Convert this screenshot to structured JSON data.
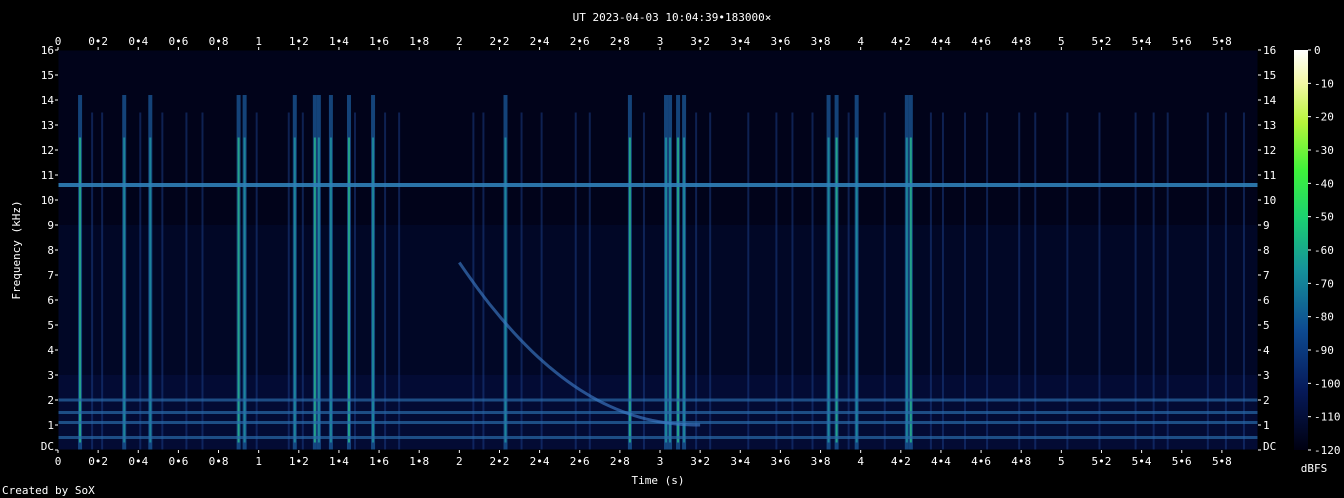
{
  "chart_data": {
    "type": "heatmap",
    "title": "UT 2023-04-03 10:04:39•183000×",
    "xlabel": "Time (s)",
    "ylabel": "Frequency (kHz)",
    "xlim": [
      0,
      5.98
    ],
    "ylim": [
      0,
      16
    ],
    "x_ticks": [
      "0",
      "0•2",
      "0•4",
      "0•6",
      "0•8",
      "1",
      "1•2",
      "1•4",
      "1•6",
      "1•8",
      "2",
      "2•2",
      "2•4",
      "2•6",
      "2•8",
      "3",
      "3•2",
      "3•4",
      "3•6",
      "3•8",
      "4",
      "4•2",
      "4•4",
      "4•6",
      "4•8",
      "5",
      "5•2",
      "5•4",
      "5•6",
      "5•8"
    ],
    "x_tick_values": [
      0,
      0.2,
      0.4,
      0.6,
      0.8,
      1,
      1.2,
      1.4,
      1.6,
      1.8,
      2,
      2.2,
      2.4,
      2.6,
      2.8,
      3,
      3.2,
      3.4,
      3.6,
      3.8,
      4,
      4.2,
      4.4,
      4.6,
      4.8,
      5,
      5.2,
      5.4,
      5.6,
      5.8
    ],
    "y_ticks": [
      "DC",
      "1",
      "2",
      "3",
      "4",
      "5",
      "6",
      "7",
      "8",
      "9",
      "10",
      "11",
      "12",
      "13",
      "14",
      "15",
      "16"
    ],
    "colorbar": {
      "label": "dBFS",
      "range": [
        -120,
        0
      ],
      "ticks": [
        "0",
        "-10",
        "-20",
        "-30",
        "-40",
        "-50",
        "-60",
        "-70",
        "-80",
        "-90",
        "-100",
        "-110",
        "-120"
      ]
    },
    "features": {
      "tone_khz": 10.6,
      "low_bands_khz": [
        0.5,
        1.1,
        1.5,
        2.0
      ],
      "spheric_times_s": [
        0.11,
        0.33,
        0.46,
        0.9,
        0.93,
        1.18,
        1.28,
        1.3,
        1.36,
        1.45,
        1.57,
        2.23,
        2.85,
        3.03,
        3.05,
        3.09,
        3.12,
        3.84,
        3.88,
        3.98,
        4.23,
        4.25
      ],
      "faint_line_times_s": [
        0.17,
        0.22,
        0.41,
        0.52,
        0.64,
        0.72,
        0.99,
        1.15,
        1.22,
        1.48,
        1.63,
        1.7,
        2.07,
        2.12,
        2.31,
        2.41,
        2.58,
        2.65,
        2.92,
        3.18,
        3.25,
        3.44,
        3.58,
        3.66,
        3.76,
        3.94,
        4.12,
        4.35,
        4.41,
        4.52,
        4.63,
        4.79,
        4.87,
        5.03,
        5.19,
        5.37,
        5.46,
        5.53,
        5.73,
        5.82,
        5.91
      ],
      "whistler": {
        "start_time_s": 2.0,
        "start_freq_khz": 7.5,
        "end_time_s": 3.2,
        "end_freq_khz": 1.0
      }
    },
    "grid": false,
    "legend": "colorbar-right"
  },
  "footer": {
    "credit": "Created by SoX"
  }
}
